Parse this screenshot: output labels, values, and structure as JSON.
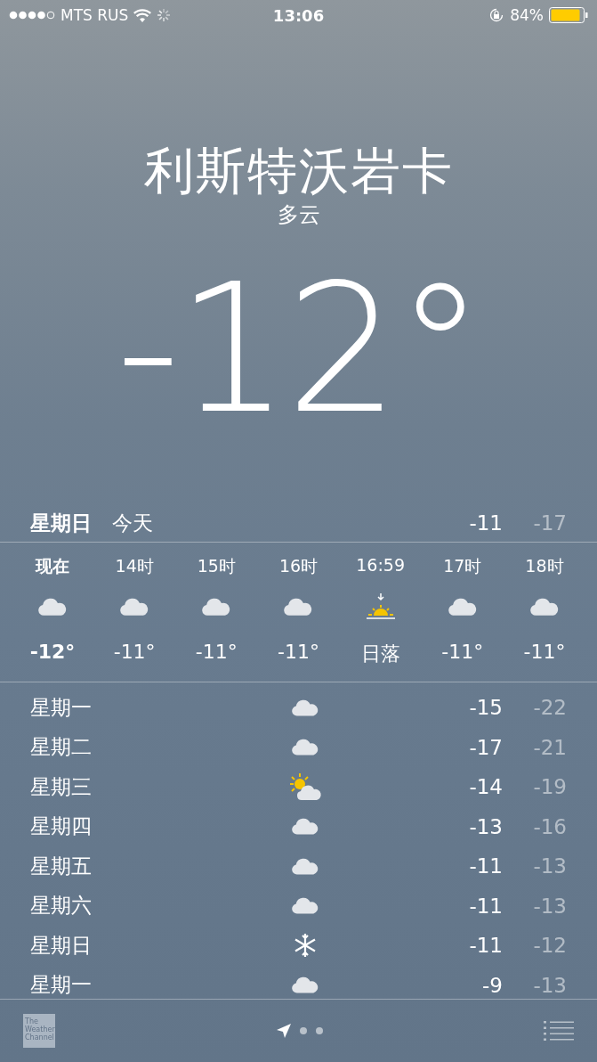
{
  "status_bar": {
    "carrier": "MTS RUS",
    "time": "13:06",
    "battery": "84%"
  },
  "location": {
    "city": "利斯特沃岩卡",
    "condition": "多云",
    "temperature": "-12°"
  },
  "today": {
    "day": "星期日",
    "label": "今天",
    "high": "-11",
    "low": "-17"
  },
  "hourly": [
    {
      "time": "现在",
      "kind": "cloud",
      "temp": "-12°",
      "now": true
    },
    {
      "time": "14时",
      "kind": "cloud",
      "temp": "-11°",
      "now": false
    },
    {
      "time": "15时",
      "kind": "cloud",
      "temp": "-11°",
      "now": false
    },
    {
      "time": "16时",
      "kind": "cloud",
      "temp": "-11°",
      "now": false
    },
    {
      "time": "16:59",
      "kind": "sunset",
      "temp": "日落",
      "now": false
    },
    {
      "time": "17时",
      "kind": "cloud",
      "temp": "-11°",
      "now": false
    },
    {
      "time": "18时",
      "kind": "cloud",
      "temp": "-11°",
      "now": false
    }
  ],
  "daily": [
    {
      "day": "星期一",
      "kind": "cloud",
      "high": "-15",
      "low": "-22"
    },
    {
      "day": "星期二",
      "kind": "cloud",
      "high": "-17",
      "low": "-21"
    },
    {
      "day": "星期三",
      "kind": "partly-sunny",
      "high": "-14",
      "low": "-19"
    },
    {
      "day": "星期四",
      "kind": "cloud",
      "high": "-13",
      "low": "-16"
    },
    {
      "day": "星期五",
      "kind": "cloud",
      "high": "-11",
      "low": "-13"
    },
    {
      "day": "星期六",
      "kind": "cloud",
      "high": "-11",
      "low": "-13"
    },
    {
      "day": "星期日",
      "kind": "snow",
      "high": "-11",
      "low": "-12"
    },
    {
      "day": "星期一",
      "kind": "cloud",
      "high": "-9",
      "low": "-13"
    }
  ],
  "footer": {
    "logo": "The Weather Channel"
  }
}
